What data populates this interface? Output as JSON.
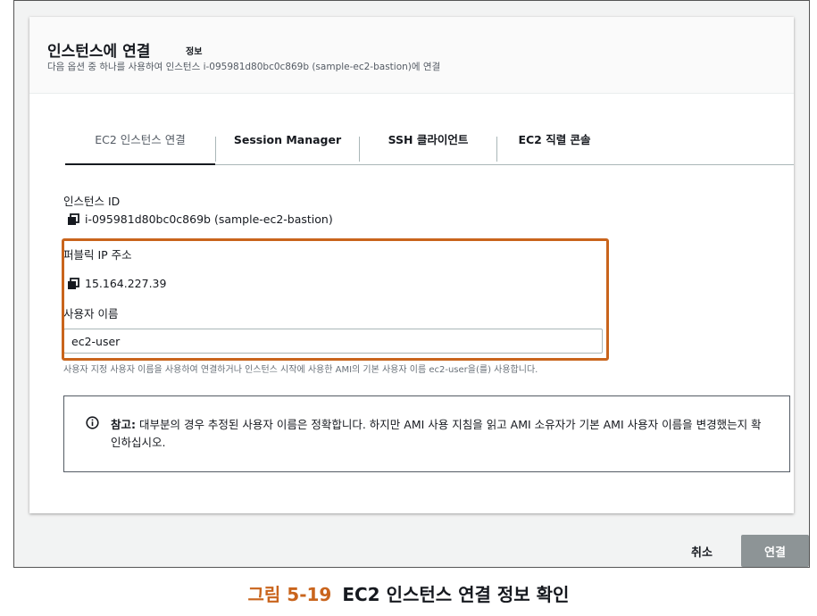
{
  "header": {
    "title": "인스턴스에 연결",
    "info_link": "정보",
    "subtitle": "다음 옵션 중 하나를 사용하여 인스턴스 i-095981d80bc0c869b (sample-ec2-bastion)에 연결"
  },
  "tabs": [
    {
      "label": "EC2 인스턴스 연결",
      "active": true
    },
    {
      "label": "Session Manager",
      "active": false
    },
    {
      "label": "SSH 클라이언트",
      "active": false
    },
    {
      "label": "EC2 직렬 콘솔",
      "active": false
    }
  ],
  "instance": {
    "id_label": "인스턴스 ID",
    "id_value": "i-095981d80bc0c869b (sample-ec2-bastion)",
    "public_ip_label": "퍼블릭 IP 주소",
    "public_ip_value": "15.164.227.39",
    "username_label": "사용자 이름",
    "username_value": "ec2-user",
    "username_hint": "사용자 지정 사용자 이름을 사용하여 연결하거나 인스턴스 시작에 사용한 AMI의 기본 사용자 이름 ec2-user을(를) 사용합니다."
  },
  "note": {
    "prefix": "참고:",
    "text": " 대부분의 경우 추정된 사용자 이름은 정확합니다. 하지만 AMI 사용 지침을 읽고 AMI 소유자가 기본 AMI 사용자 이름을 변경했는지 확인하십시오."
  },
  "footer": {
    "cancel_label": "취소",
    "connect_label": "연결"
  },
  "caption": {
    "figure": "그림 5-19",
    "text": "EC2 인스턴스 연결 정보 확인"
  },
  "colors": {
    "highlight": "#c9641c",
    "connect_button": "#8d9496"
  },
  "icons": {
    "copy": "copy-icon",
    "info": "info-circle-icon"
  }
}
